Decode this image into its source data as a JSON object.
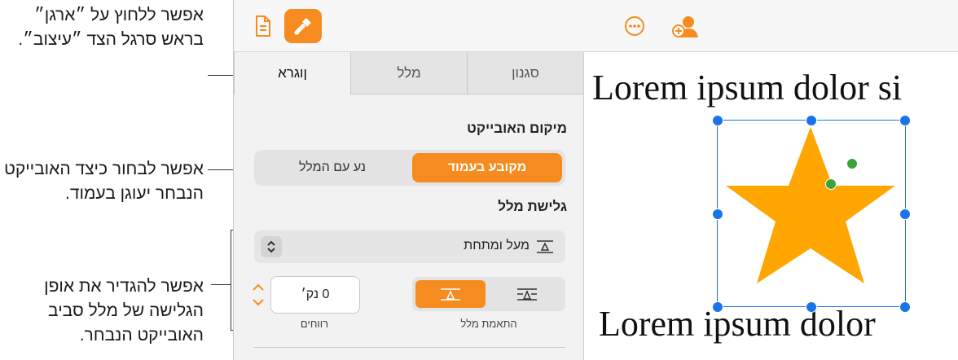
{
  "callouts": {
    "arrange_tab": "אפשר ללחוץ על ״ארגן״ בראש סרגל הצד ״עיצוב״.",
    "object_placement": "אפשר לבחור כיצד האובייקט הנבחר יעוגן בעמוד.",
    "text_wrap": "אפשר להגדיר את אופן הגלישה של מלל סביב האובייקט הנבחר."
  },
  "toolbar": {
    "document_icon": "document-icon",
    "format_icon": "paintbrush-icon",
    "more_icon": "ellipsis-circle-icon",
    "collaborate_icon": "person-add-icon",
    "accent": "#f68b1f"
  },
  "sidebar": {
    "tabs": [
      "סגנון",
      "מלל",
      "ןוגרא"
    ],
    "active_tab": "ןוגרא",
    "object_placement": {
      "title": "מיקום האובייקט",
      "options": [
        "מקובע בעמוד",
        "נע עם המלל"
      ],
      "selected": "מקובע בעמוד"
    },
    "text_wrap": {
      "title": "גלישת מלל",
      "value": "מעל ומתחת",
      "text_fit_label": "התאמת מלל",
      "spacing_label": "רווחים",
      "spacing_value": "0 נק׳"
    }
  },
  "canvas": {
    "line1": "Lorem ipsum dolor si",
    "line2": "Lorem ipsum dolor",
    "star_color": "#ffa600",
    "handle_color": "#1a73e8",
    "rotate_handle_color": "#3aa33a"
  }
}
